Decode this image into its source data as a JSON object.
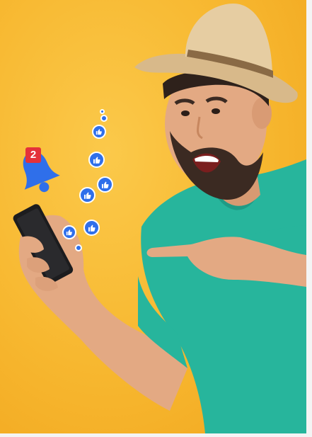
{
  "notification": {
    "badge_count": "2",
    "icon": "bell-icon",
    "bell_color": "#2f6fea",
    "badge_color": "#e4313a"
  },
  "reactions": {
    "icon": "thumbs-up-icon",
    "color": "#2f6fea"
  },
  "background_color": "#f7b72f",
  "shirt_color": "#27b59c",
  "hat_color": "#e2c79a"
}
